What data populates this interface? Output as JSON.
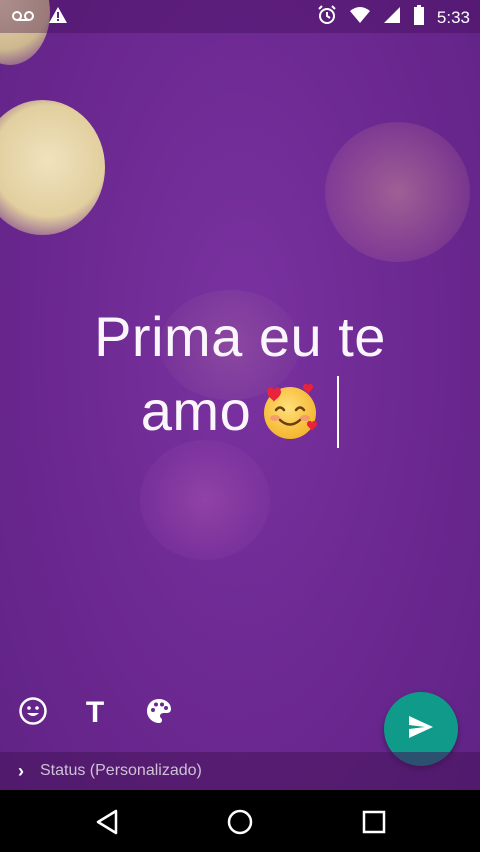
{
  "status_bar": {
    "time": "5:33",
    "icons": [
      "voicemail-icon",
      "warning-icon",
      "alarm-icon",
      "wifi-icon",
      "signal-icon",
      "battery-icon"
    ]
  },
  "editor": {
    "text_line1": "Prima eu te",
    "text_line2": "amo",
    "emoji": "smiling-face-with-hearts",
    "background_color": "#6b2890"
  },
  "toolbar": {
    "icons": [
      "emoji-icon",
      "text-icon",
      "palette-icon"
    ],
    "text_tool_label": "T"
  },
  "send_button": {
    "icon": "send-icon",
    "color": "#0f9a8a"
  },
  "caption": {
    "chevron": "›",
    "label": "Status (Personalizado)"
  },
  "nav_bar": {
    "icons": [
      "back-icon",
      "home-icon",
      "recents-icon"
    ]
  }
}
